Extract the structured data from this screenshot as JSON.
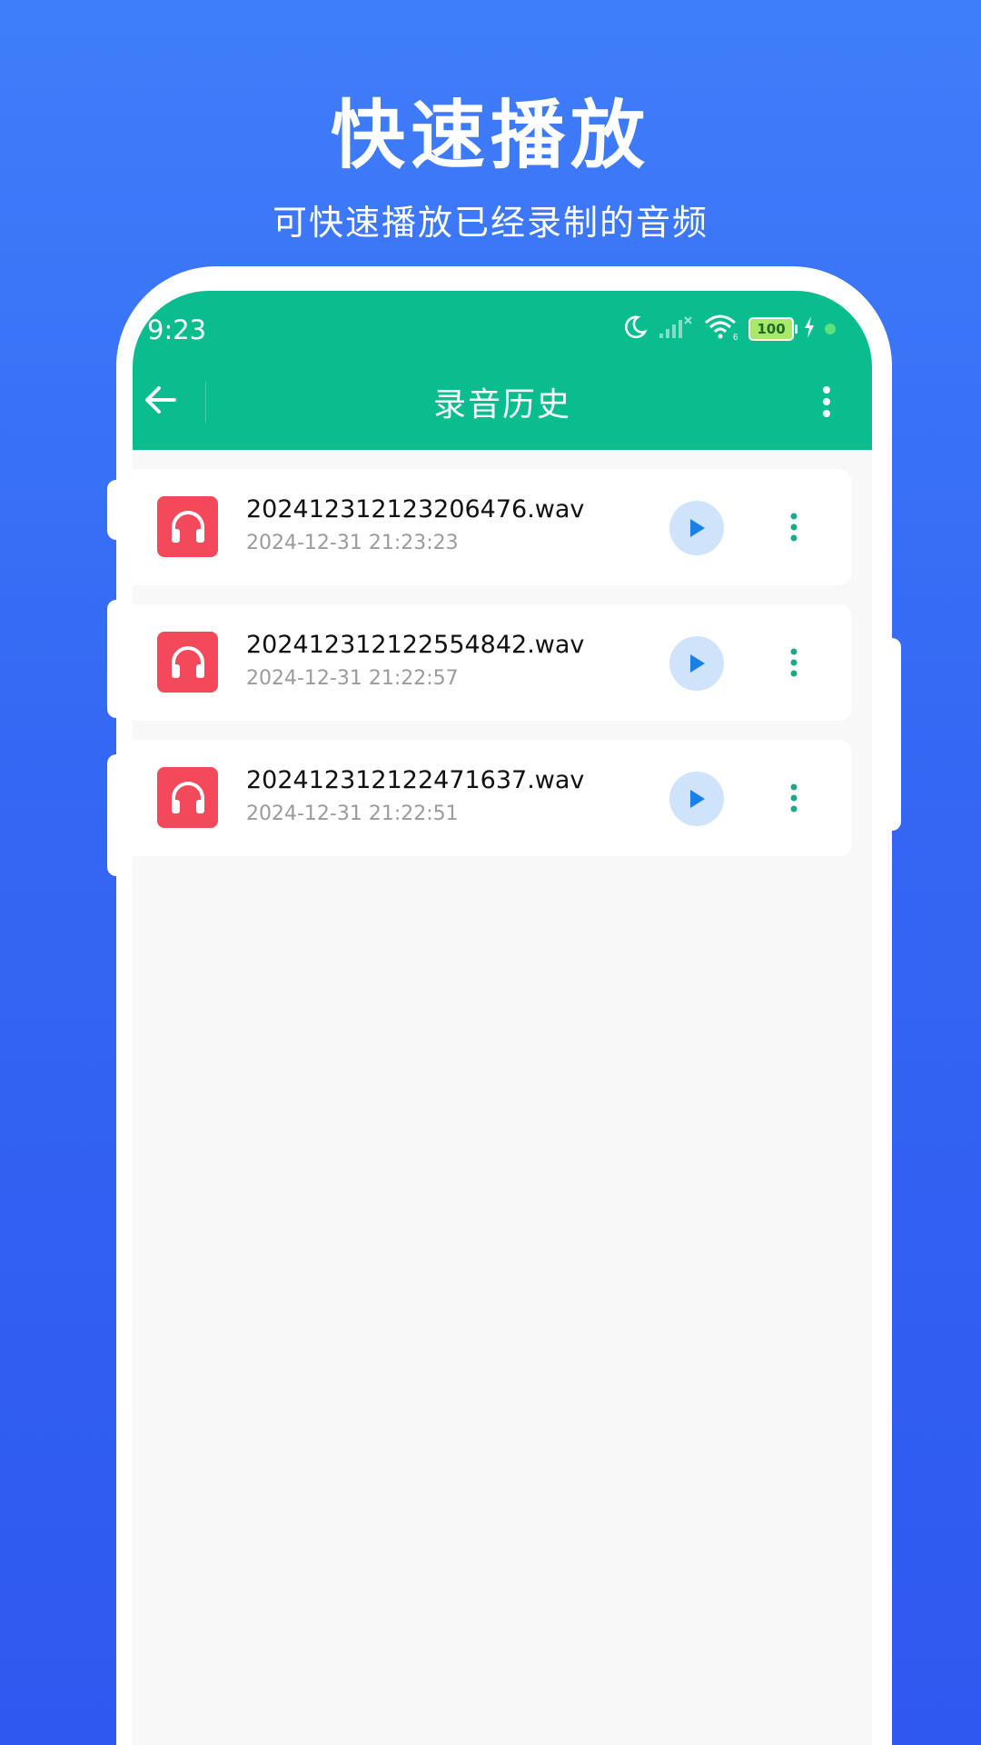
{
  "promo": {
    "title": "快速播放",
    "subtitle": "可快速播放已经录制的音频"
  },
  "status_bar": {
    "time": "9:23",
    "battery": "100",
    "icons": [
      "moon-icon",
      "signal-icon",
      "wifi-icon",
      "battery-icon",
      "charging-icon"
    ]
  },
  "app_bar": {
    "title": "录音历史",
    "back_icon": "arrow-left-icon",
    "menu_icon": "more-vertical-icon"
  },
  "recordings": [
    {
      "name": "202412312123206476.wav",
      "time": "2024-12-31 21:23:23"
    },
    {
      "name": "202412312122554842.wav",
      "time": "2024-12-31 21:22:57"
    },
    {
      "name": "202412312122471637.wav",
      "time": "2024-12-31 21:22:51"
    }
  ],
  "colors": {
    "background": "#3467f3",
    "app_bar": "#09bd8e",
    "file_icon": "#f4495a",
    "play_bg": "#cfe4fb",
    "play_icon": "#1a7fe6",
    "menu_dots": "#1aa98b"
  }
}
